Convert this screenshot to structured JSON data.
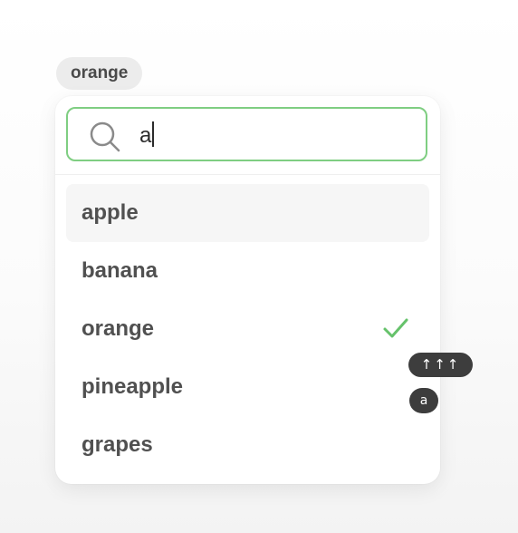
{
  "selected_chip": "orange",
  "search": {
    "value": "a",
    "icon": "search-icon",
    "border_color": "#7fce82"
  },
  "options": [
    {
      "label": "apple",
      "highlighted": true,
      "selected": false
    },
    {
      "label": "banana",
      "highlighted": false,
      "selected": false
    },
    {
      "label": "orange",
      "highlighted": false,
      "selected": true
    },
    {
      "label": "pineapple",
      "highlighted": false,
      "selected": false
    },
    {
      "label": "grapes",
      "highlighted": false,
      "selected": false
    }
  ],
  "check_icon": {
    "name": "check-icon",
    "color": "#66c26b"
  },
  "key_overlay": {
    "arrows": "↑↑↑",
    "key": "a"
  }
}
